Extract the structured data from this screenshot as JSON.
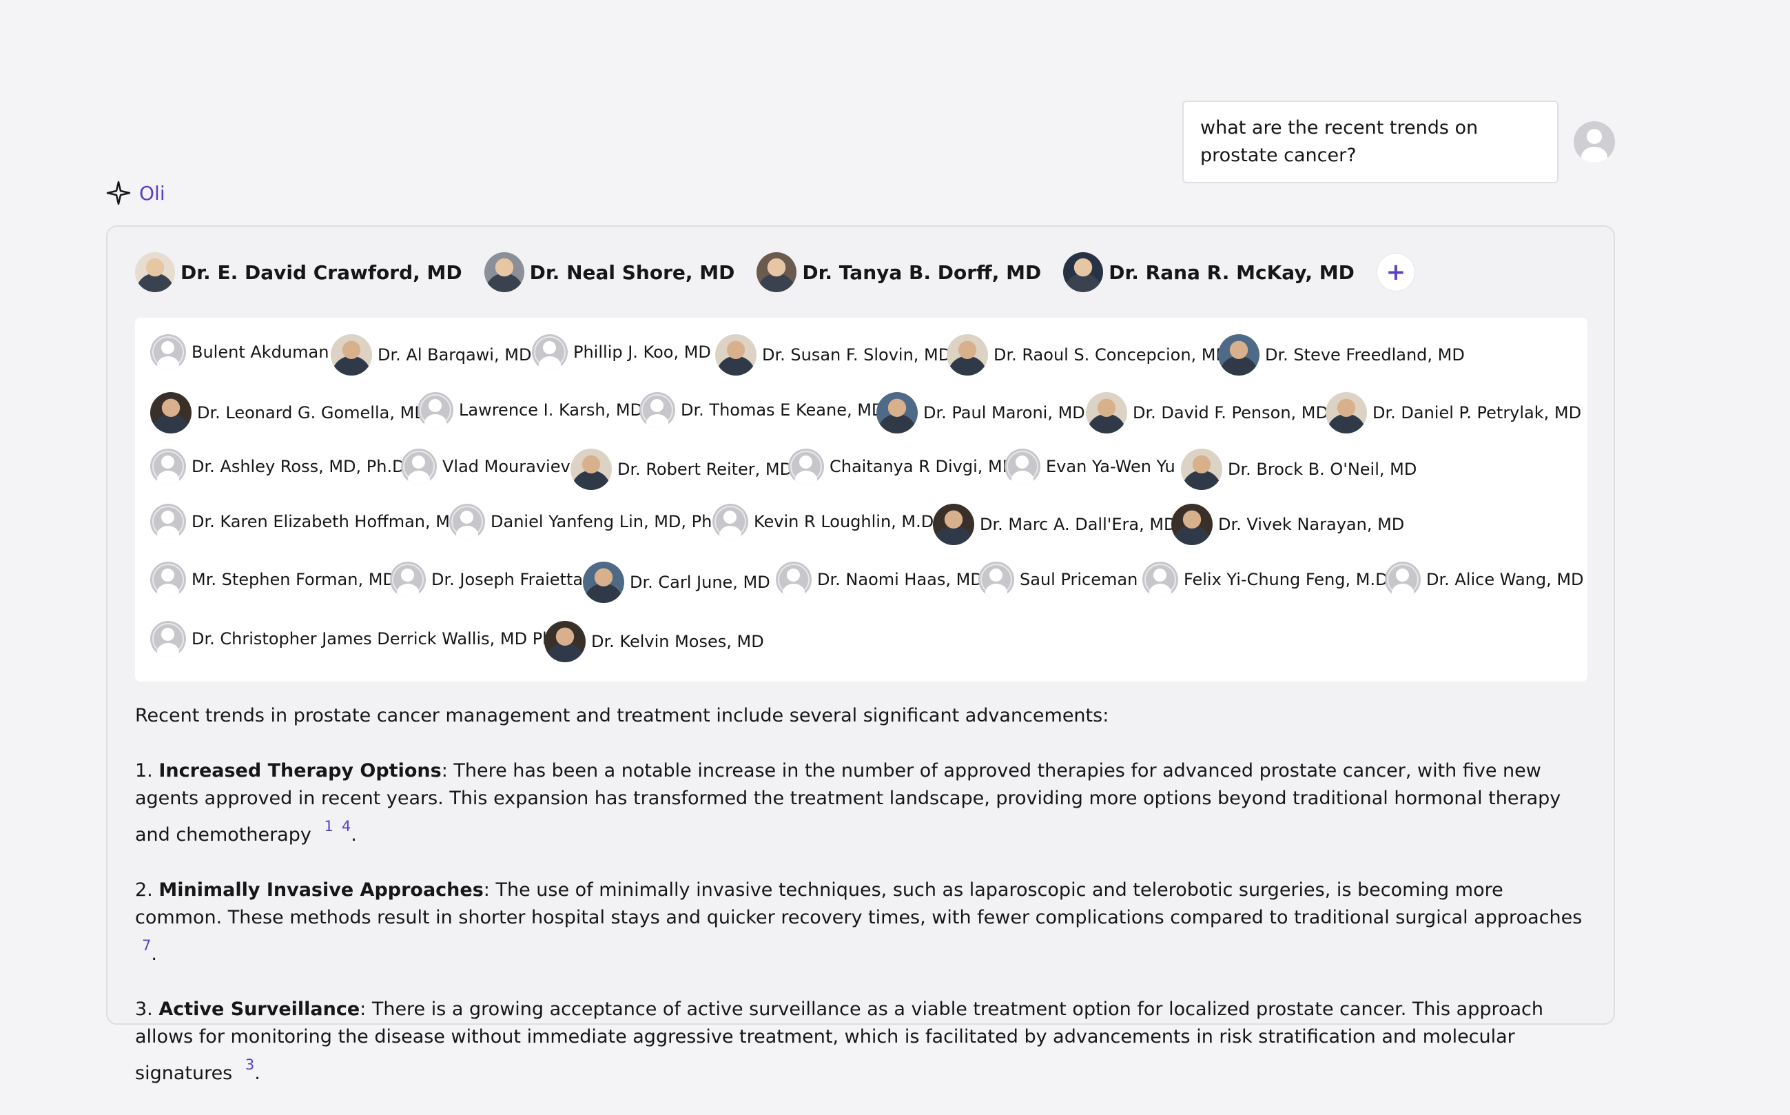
{
  "user": {
    "question": "what are the recent trends on prostate cancer?"
  },
  "assistant": {
    "name": "Oli"
  },
  "primary_experts": [
    {
      "name": "Dr. E. David Crawford, MD"
    },
    {
      "name": "Dr. Neal Shore, MD"
    },
    {
      "name": "Dr. Tanya B. Dorff, MD"
    },
    {
      "name": "Dr. Rana R. McKay, MD"
    }
  ],
  "add_button_label": "+",
  "experts": [
    {
      "name": "Bulent Akduman"
    },
    {
      "name": "Dr. Al Barqawi, MD"
    },
    {
      "name": "Phillip J. Koo, MD"
    },
    {
      "name": "Dr. Susan F. Slovin, MD"
    },
    {
      "name": "Dr. Raoul S. Concepcion, MD"
    },
    {
      "name": "Dr. Steve Freedland, MD"
    },
    {
      "name": "Dr. Leonard G. Gomella, MD"
    },
    {
      "name": "Lawrence I. Karsh, MD"
    },
    {
      "name": "Dr. Thomas E Keane, MD"
    },
    {
      "name": "Dr. Paul Maroni, MD"
    },
    {
      "name": "Dr. David F. Penson, MD"
    },
    {
      "name": "Dr. Daniel P. Petrylak, MD"
    },
    {
      "name": "Dr. Ashley Ross, MD, Ph.D."
    },
    {
      "name": "Vlad Mouraviev"
    },
    {
      "name": "Dr. Robert Reiter, MD"
    },
    {
      "name": "Chaitanya R Divgi, MD"
    },
    {
      "name": "Evan Ya-Wen Yu"
    },
    {
      "name": "Dr. Brock B. O'Neil, MD"
    },
    {
      "name": "Dr. Karen Elizabeth Hoffman, MD"
    },
    {
      "name": "Daniel Yanfeng Lin, MD, PhD"
    },
    {
      "name": "Kevin R Loughlin, M.D."
    },
    {
      "name": "Dr. Marc A. Dall'Era, MD"
    },
    {
      "name": "Dr. Vivek Narayan, MD"
    },
    {
      "name": "Mr. Stephen Forman, MD"
    },
    {
      "name": "Dr. Joseph Fraietta"
    },
    {
      "name": "Dr. Carl June, MD"
    },
    {
      "name": "Dr. Naomi Haas, MD"
    },
    {
      "name": "Saul Priceman"
    },
    {
      "name": "Felix Yi-Chung Feng, M.D."
    },
    {
      "name": "Dr. Alice Wang, MD"
    },
    {
      "name": "Dr. Christopher James Derrick Wallis, MD PhD"
    },
    {
      "name": "Dr. Kelvin Moses, MD"
    }
  ],
  "answer": {
    "intro": "Recent trends in prostate cancer management and treatment include several significant advancements:",
    "items": [
      {
        "number": "1.",
        "title": "Increased Therapy Options",
        "text": ": There has been a notable increase in the number of approved therapies for advanced prostate cancer, with five new agents approved in recent years. This expansion has transformed the treatment landscape, providing more options beyond traditional hormonal therapy and chemotherapy",
        "citations": [
          "1",
          "4"
        ]
      },
      {
        "number": "2.",
        "title": "Minimally Invasive Approaches",
        "text": ": The use of minimally invasive techniques, such as laparoscopic and telerobotic surgeries, is becoming more common. These methods result in shorter hospital stays and quicker recovery times, with fewer complications compared to traditional surgical approaches",
        "citations": [
          "7"
        ]
      },
      {
        "number": "3.",
        "title": "Active Surveillance",
        "text": ": There is a growing acceptance of active surveillance as a viable treatment option for localized prostate cancer. This approach allows for monitoring the disease without immediate aggressive treatment, which is facilitated by advancements in risk stratification and molecular signatures",
        "citations": [
          "3"
        ]
      }
    ],
    "period": "."
  },
  "colors": {
    "accent": "#5b3fc8",
    "background": "#f4f4f6",
    "panel": "#f2f2f5"
  }
}
